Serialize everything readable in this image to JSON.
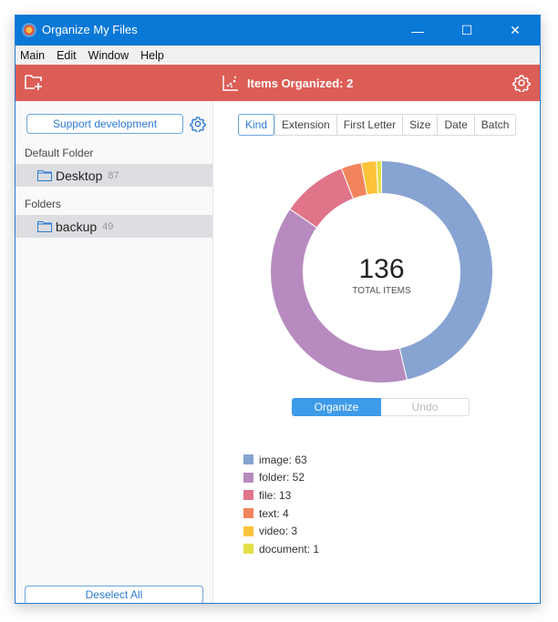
{
  "window": {
    "title": "Organize My Files",
    "controls": {
      "minimize": "—",
      "maximize": "☐",
      "close": "✕"
    }
  },
  "menu": [
    "Main",
    "Edit",
    "Window",
    "Help"
  ],
  "toolbar": {
    "items_organized_label": "Items Organized: 2"
  },
  "sidebar": {
    "support_button": "Support development",
    "default_folder_label": "Default Folder",
    "default_folder": {
      "name": "Desktop",
      "count": "87"
    },
    "folders_label": "Folders",
    "folders": [
      {
        "name": "backup",
        "count": "49"
      }
    ],
    "deselect_button": "Deselect All"
  },
  "main": {
    "tabs": [
      "Kind",
      "Extension",
      "First Letter",
      "Size",
      "Date",
      "Batch"
    ],
    "active_tab": "Kind",
    "organize_button": "Organize",
    "undo_button": "Undo"
  },
  "chart_data": {
    "type": "pie",
    "variant": "donut",
    "center_value": "136",
    "center_label": "TOTAL ITEMS",
    "categories": [
      "image",
      "folder",
      "file",
      "text",
      "video",
      "document"
    ],
    "values": [
      63,
      52,
      13,
      4,
      3,
      1
    ],
    "colors": [
      "#87a3d1",
      "#b78bbf",
      "#e07489",
      "#f2845c",
      "#fcc33a",
      "#e3e04a"
    ],
    "legend": [
      "image: 63",
      "folder: 52",
      "file: 13",
      "text: 4",
      "video: 3",
      "document: 1"
    ],
    "legend_position": "bottom-left"
  },
  "colors": {
    "titlebar": "#0a78d7",
    "toolbar": "#dc5d56",
    "accent": "#3e9be9"
  }
}
